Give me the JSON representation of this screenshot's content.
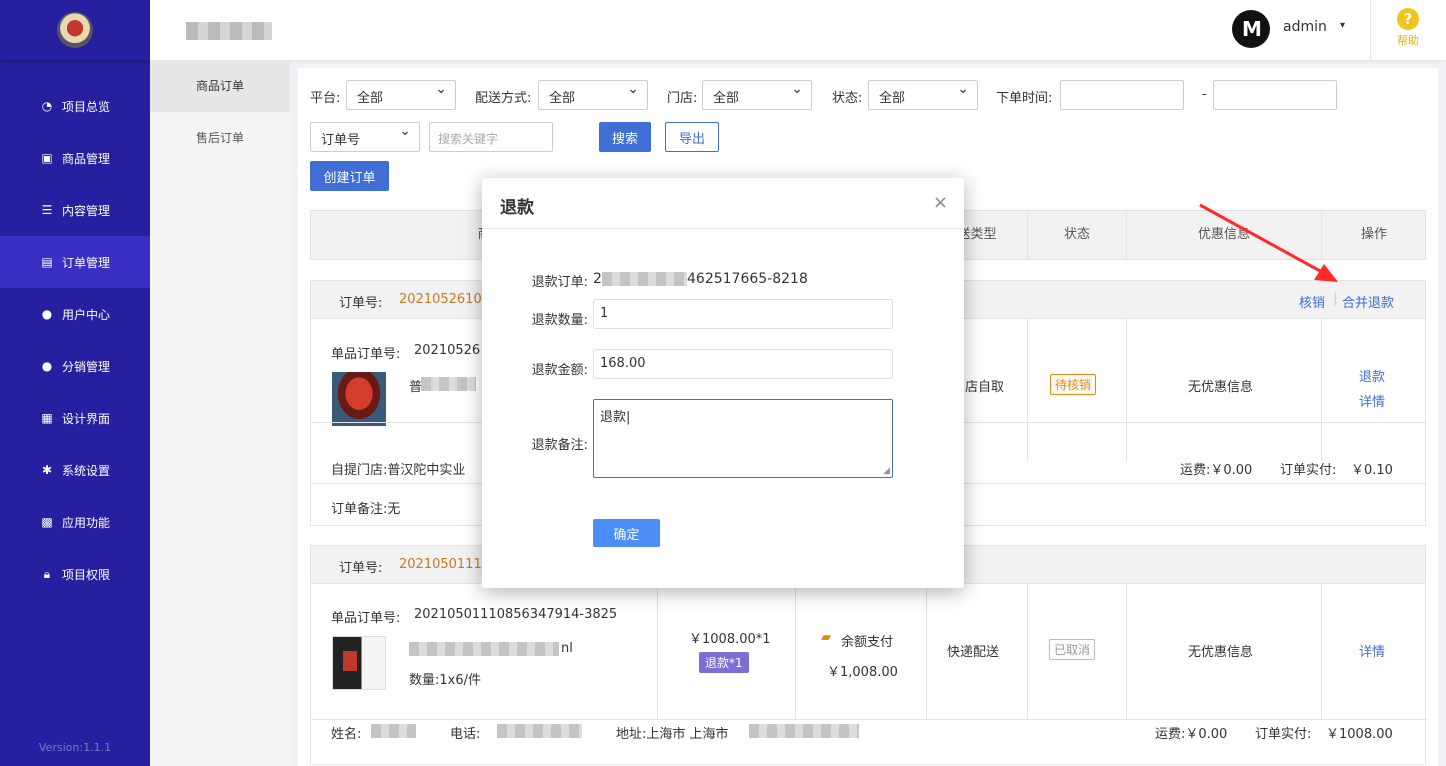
{
  "sidebar": {
    "items": [
      {
        "label": "项目总览",
        "icon": "pie-chart-icon",
        "glyph": "◔"
      },
      {
        "label": "商品管理",
        "icon": "bag-icon",
        "glyph": "▣"
      },
      {
        "label": "内容管理",
        "icon": "list-icon",
        "glyph": "☰"
      },
      {
        "label": "订单管理",
        "icon": "document-icon",
        "glyph": "▤"
      },
      {
        "label": "用户中心",
        "icon": "user-icon",
        "glyph": "●"
      },
      {
        "label": "分销管理",
        "icon": "users-icon",
        "glyph": "●"
      },
      {
        "label": "设计界面",
        "icon": "layout-icon",
        "glyph": "▦"
      },
      {
        "label": "系统设置",
        "icon": "gear-icon",
        "glyph": "✱"
      },
      {
        "label": "应用功能",
        "icon": "grid-icon",
        "glyph": "▩"
      },
      {
        "label": "项目权限",
        "icon": "lock-icon",
        "glyph": "🔒︎"
      }
    ],
    "active_index": 3,
    "version": "Version:1.1.1"
  },
  "header": {
    "avatar_text": "M",
    "username": "admin",
    "caret": "▾",
    "help_label": "帮助",
    "help_glyph": "?"
  },
  "subnav": {
    "items": [
      "商品订单",
      "售后订单"
    ],
    "active_index": 0
  },
  "filters": {
    "platform_label": "平台:",
    "platform_value": "全部",
    "delivery_label": "配送方式:",
    "delivery_value": "全部",
    "store_label": "门店:",
    "store_value": "全部",
    "status_label": "状态:",
    "status_value": "全部",
    "time_label": "下单时间:",
    "time_sep": "-",
    "field_value": "订单号",
    "search_placeholder": "搜索关键字",
    "search_button": "搜索",
    "export_button": "导出",
    "create_button": "创建订单"
  },
  "table": {
    "headers": [
      "商",
      "送类型",
      "状态",
      "优惠信息",
      "操作"
    ]
  },
  "orders": [
    {
      "order_no_label": "订单号:",
      "order_no": "2021052610",
      "action_verify": "核销",
      "action_merge_refund": "合并退款",
      "sub_order_label": "单品订单号:",
      "sub_order_no": "20210526",
      "product_prefix": "普",
      "delivery": "店自取",
      "status": "待核销",
      "discount": "无优惠信息",
      "action_refund": "退款",
      "action_detail": "详情",
      "store_label": "自提门店:普汉陀中实业",
      "freight": "运费:￥0.00",
      "paid_label": "订单实付:",
      "paid_value": "￥0.10",
      "remark": "订单备注:无"
    },
    {
      "order_no_label": "订单号:",
      "order_no": "2021050111",
      "sub_order_label": "单品订单号:",
      "sub_order_no": "20210501110856347914-3825",
      "product_suffix": "nl",
      "quantity": "数量:1x6/件",
      "price": "￥1008.00*1",
      "refund_badge": "退款*1",
      "pay_method": "余额支付",
      "pay_amount": "￥1,008.00",
      "delivery": "快递配送",
      "status": "已取消",
      "discount": "无优惠信息",
      "action_detail": "详情",
      "name_label": "姓名:",
      "phone_label": "电话:",
      "address_label": "地址:上海市 上海市",
      "freight": "运费:￥0.00",
      "paid_label": "订单实付:",
      "paid_value": "￥1008.00"
    }
  ],
  "modal": {
    "title": "退款",
    "close": "×",
    "order_label": "退款订单:",
    "order_prefix": "2",
    "order_suffix": "462517665-8218",
    "qty_label": "退款数量:",
    "qty_value": "1",
    "amount_label": "退款金额:",
    "amount_value": "168.00",
    "remark_label": "退款备注:",
    "remark_value": "退款",
    "confirm": "确定"
  },
  "colors": {
    "sidebar": "#2620a0",
    "primary": "#3f6ed6",
    "order_no": "#c97a1a",
    "price_red": "#d81e06",
    "arrow": "#ff2a2a"
  }
}
